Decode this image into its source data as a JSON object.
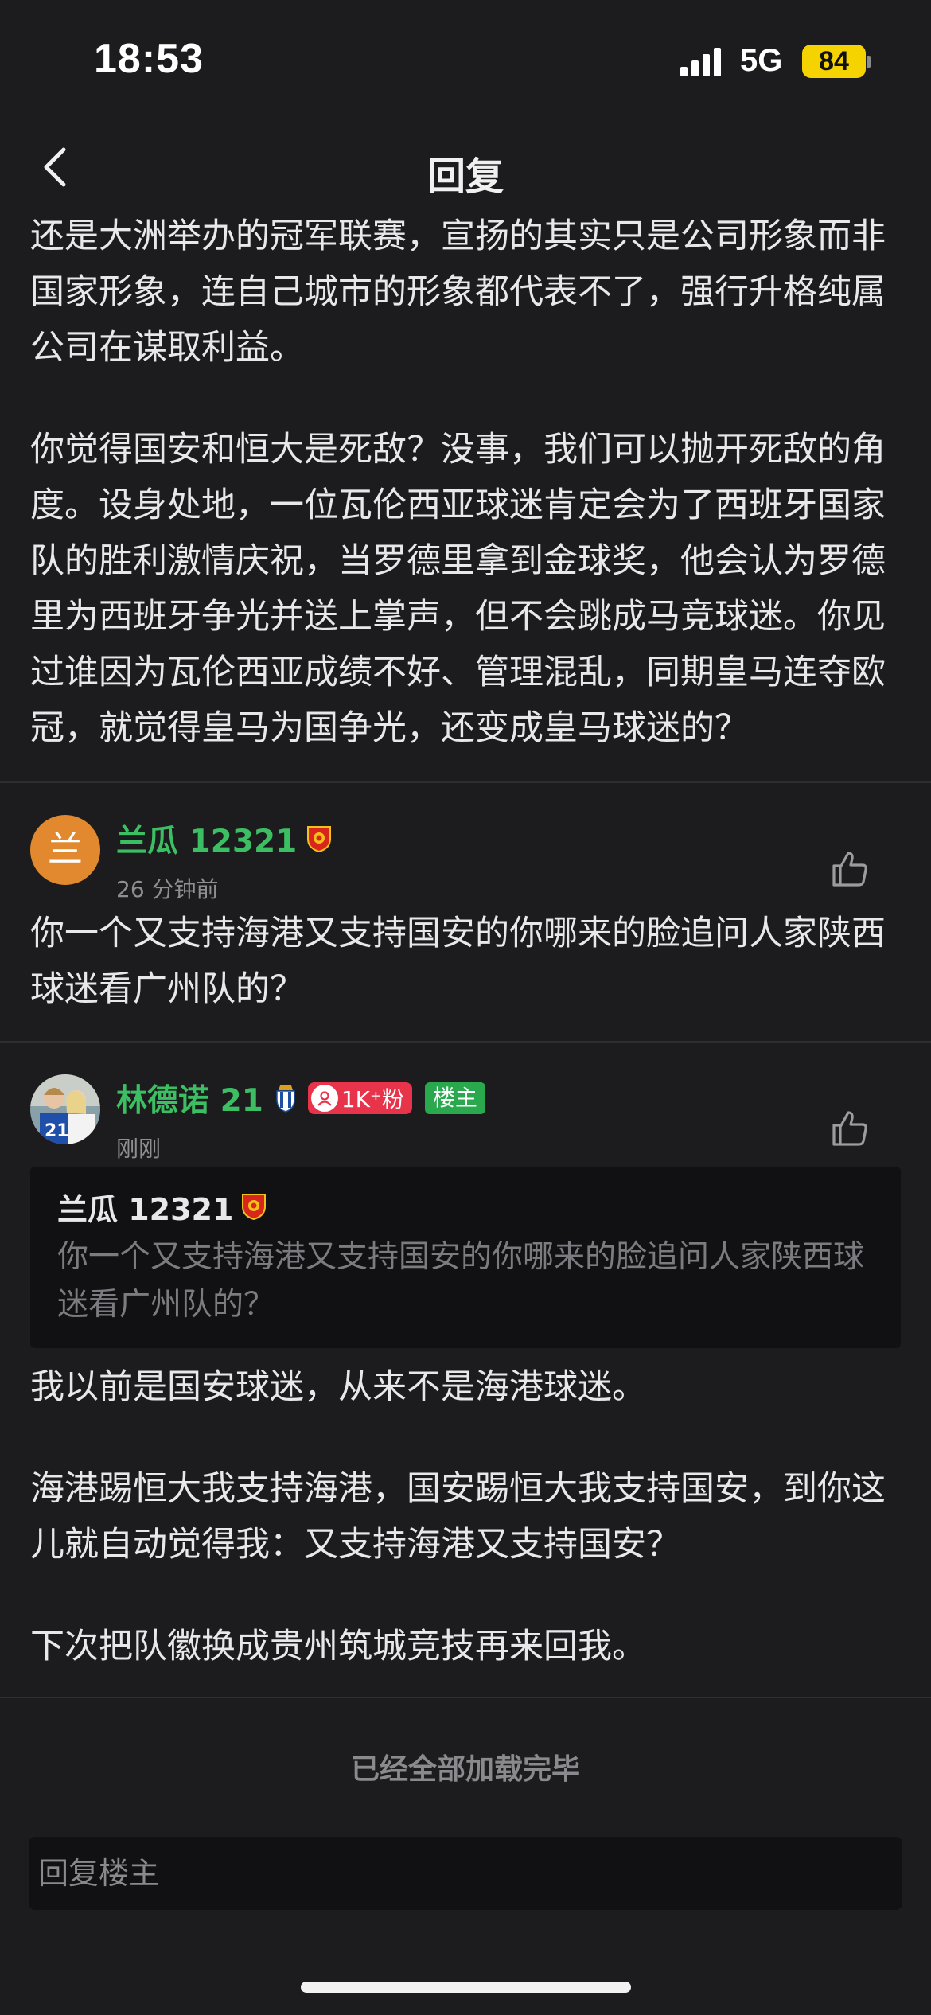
{
  "status": {
    "time": "18:53",
    "network": "5G",
    "battery": "84"
  },
  "nav": {
    "title": "回复"
  },
  "post": {
    "paragraphs": [
      "还是大洲举办的冠军联赛，宣扬的其实只是公司形象而非国家形象，连自己城市的形象都代表不了，强行升格纯属公司在谋取利益。",
      "你觉得国安和恒大是死敌？没事，我们可以抛开死敌的角度。设身处地，一位瓦伦西亚球迷肯定会为了西班牙国家队的胜利激情庆祝，当罗德里拿到金球奖，他会认为罗德里为西班牙争光并送上掌声，但不会跳成马竞球迷。你见过谁因为瓦伦西亚成绩不好、管理混乱，同期皇马连夺欧冠，就觉得皇马为国争光，还变成皇马球迷的？"
    ]
  },
  "comments": [
    {
      "avatar_letter": "兰",
      "username": "兰瓜 12321",
      "time": "26 分钟前",
      "text": "你一个又支持海港又支持国安的你哪来的脸追问人家陕西球迷看广州队的？"
    },
    {
      "username": "林德诺 21",
      "fans": "1K⁺粉",
      "op_label": "楼主",
      "time": "刚刚",
      "quote": {
        "username": "兰瓜 12321",
        "text": "你一个又支持海港又支持国安的你哪来的脸追问人家陕西球迷看广州队的？"
      },
      "paragraphs": [
        "我以前是国安球迷，从来不是海港球迷。",
        "海港踢恒大我支持海港，国安踢恒大我支持国安，到你这儿就自动觉得我：又支持海港又支持国安？",
        "下次把队徽换成贵州筑城竞技再来回我。"
      ]
    }
  ],
  "footer": {
    "loaded": "已经全部加载完毕",
    "reply_placeholder": "回复楼主"
  },
  "colors": {
    "background": "#1c1c1e",
    "username": "#3cbf63",
    "fans_badge": "#e8344a",
    "op_badge": "#29a84e",
    "battery": "#f5d300"
  },
  "icons": [
    "back-arrow-icon",
    "thumbs-up-icon",
    "guangzhou-team-badge-icon",
    "espanyol-team-badge-icon",
    "fan-icon",
    "signal-icon"
  ]
}
